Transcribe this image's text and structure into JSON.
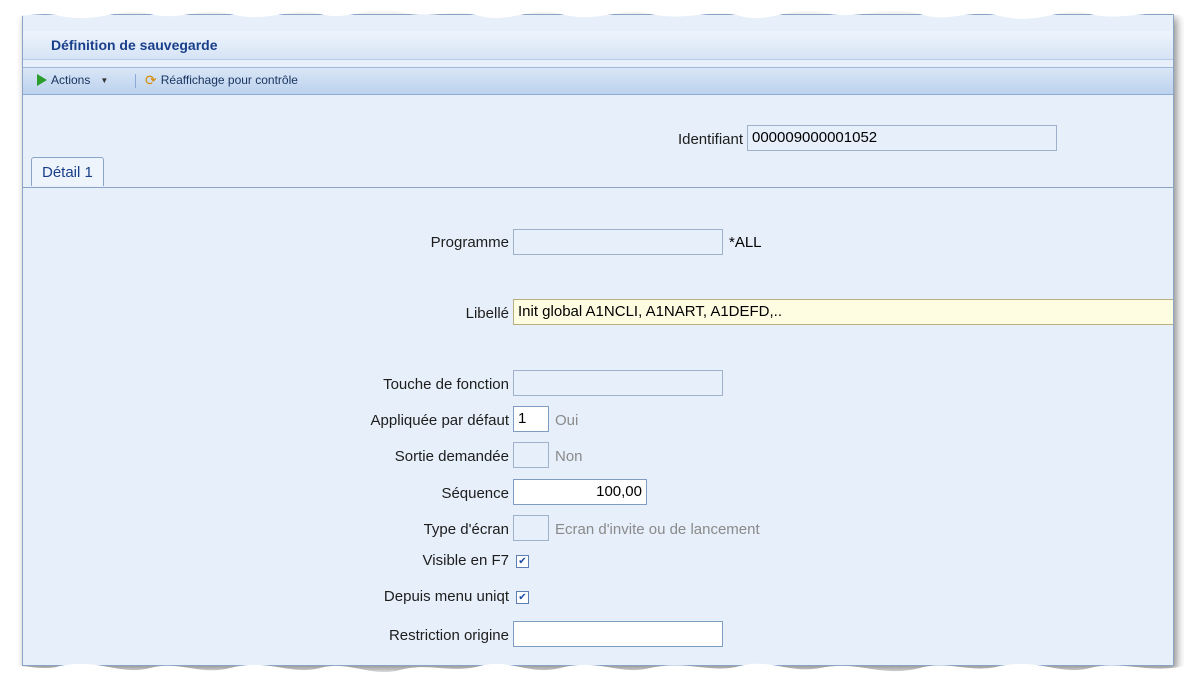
{
  "window": {
    "title": "Définition de sauvegarde"
  },
  "toolbar": {
    "actions_label": "Actions",
    "refresh_label": "Réaffichage pour contrôle"
  },
  "header": {
    "identifiant_label": "Identifiant",
    "identifiant_value": "000009000001052"
  },
  "tabs": [
    {
      "label": "Détail 1",
      "active": true
    }
  ],
  "form": {
    "programme": {
      "label": "Programme",
      "value": "",
      "suffix": "*ALL"
    },
    "libelle": {
      "label": "Libellé",
      "value": "Init global A1NCLI, A1NART, A1DEFD,.."
    },
    "touche": {
      "label": "Touche de fonction",
      "value": ""
    },
    "appliquee": {
      "label": "Appliquée par défaut",
      "value": "1",
      "hint": "Oui"
    },
    "sortie": {
      "label": "Sortie demandée",
      "value": "",
      "hint": "Non"
    },
    "sequence": {
      "label": "Séquence",
      "value": "100,00"
    },
    "type_ecran": {
      "label": "Type d'écran",
      "value": "",
      "hint": "Ecran d'invite ou de lancement"
    },
    "visible_f7": {
      "label": "Visible en F7",
      "checked": true
    },
    "depuis_menu": {
      "label": "Depuis menu uniqt",
      "checked": true
    },
    "restriction": {
      "label": "Restriction origine",
      "value": ""
    }
  },
  "colors": {
    "background": "#e6effa",
    "title": "#1a3f8a",
    "libelle_field": "#fffde1"
  }
}
